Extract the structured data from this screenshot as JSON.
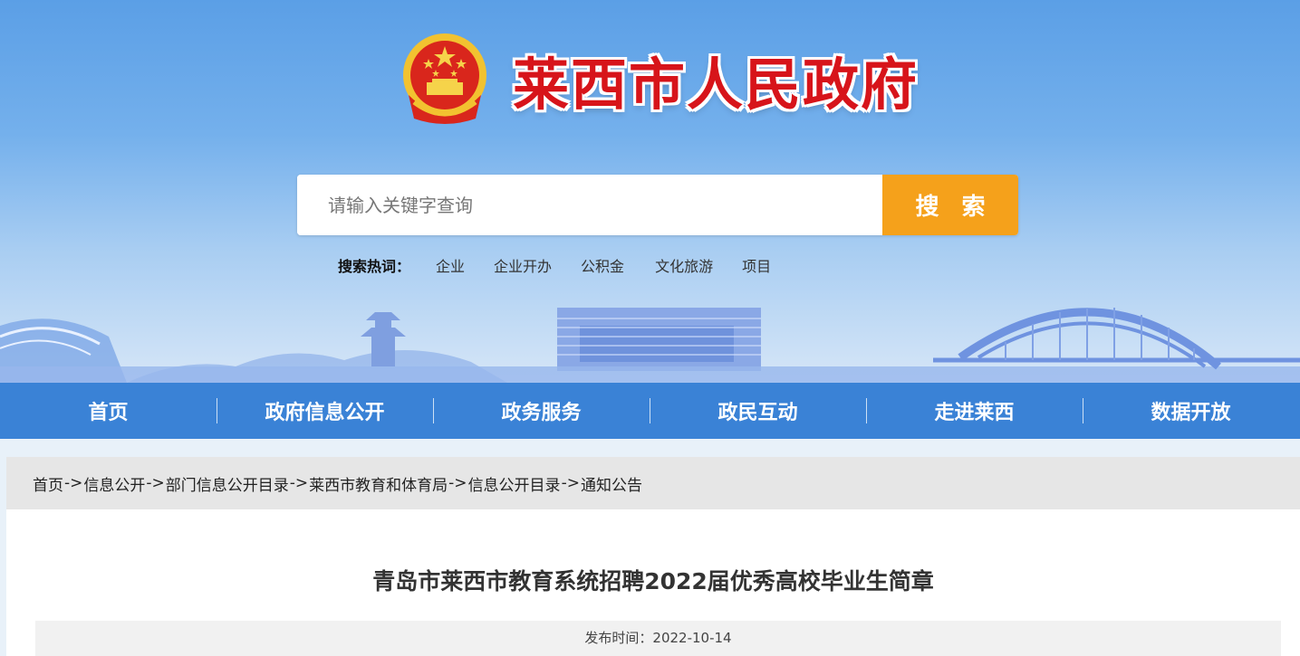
{
  "header": {
    "site_title": "莱西市人民政府",
    "emblem": "national-emblem"
  },
  "search": {
    "placeholder": "请输入关键字查询",
    "button_label": "搜 索",
    "hot_label": "搜索热词：",
    "hot_words": [
      "企业",
      "企业开办",
      "公积金",
      "文化旅游",
      "项目"
    ]
  },
  "nav": {
    "items": [
      "首页",
      "政府信息公开",
      "政务服务",
      "政民互动",
      "走进莱西",
      "数据开放"
    ]
  },
  "breadcrumb": {
    "items": [
      "首页",
      "信息公开",
      "部门信息公开目录",
      "莱西市教育和体育局",
      "信息公开目录",
      "通知公告"
    ],
    "separator": "->"
  },
  "article": {
    "title": "青岛市莱西市教育系统招聘2022届优秀高校毕业生简章",
    "publish_label": "发布时间：",
    "publish_date": "2022-10-14"
  },
  "colors": {
    "nav_bg": "#3a82d6",
    "search_button": "#f5a11b",
    "title_red": "#d7141a"
  }
}
